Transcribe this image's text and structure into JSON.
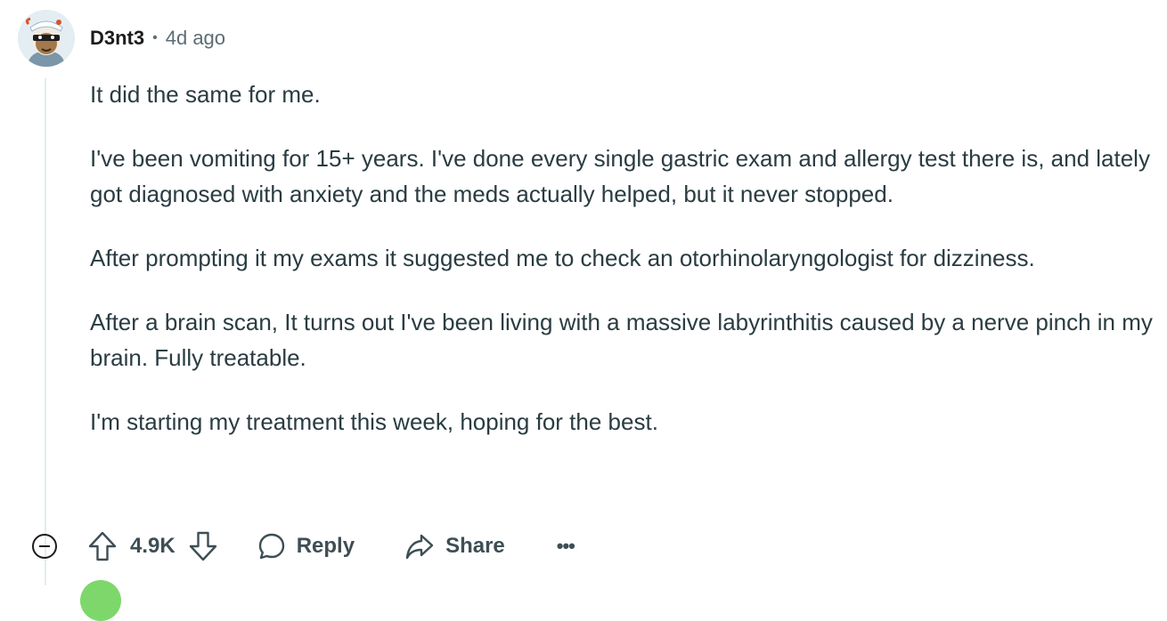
{
  "comment": {
    "author": "D3nt3",
    "separator": "•",
    "time": "4d ago",
    "avatar_icon": "snoo-avatar-icon",
    "paragraphs": [
      "It did the same for me.",
      "I've been vomiting for 15+ years. I've done every single gastric exam and allergy test there is, and lately got diagnosed with anxiety and the meds actually helped, but it never stopped.",
      "After prompting it my exams it suggested me to check an otorhinolaryngologist for dizziness.",
      "After a brain scan, It turns out I've been living with a massive labyrinthitis caused by a nerve pinch in my brain. Fully treatable.",
      "I'm starting my treatment this week, hoping for the best."
    ]
  },
  "actions": {
    "collapse_icon": "collapse-minus-icon",
    "upvote_icon": "upvote-arrow-icon",
    "score": "4.9K",
    "downvote_icon": "downvote-arrow-icon",
    "reply_label": "Reply",
    "reply_icon": "speech-bubble-icon",
    "share_label": "Share",
    "share_icon": "share-arrow-icon",
    "more_label": "•••"
  },
  "colors": {
    "text": "#2a3c42",
    "meta": "#5c6c74",
    "thread_line": "#e5ebee",
    "next_avatar": "#7ed76a"
  }
}
